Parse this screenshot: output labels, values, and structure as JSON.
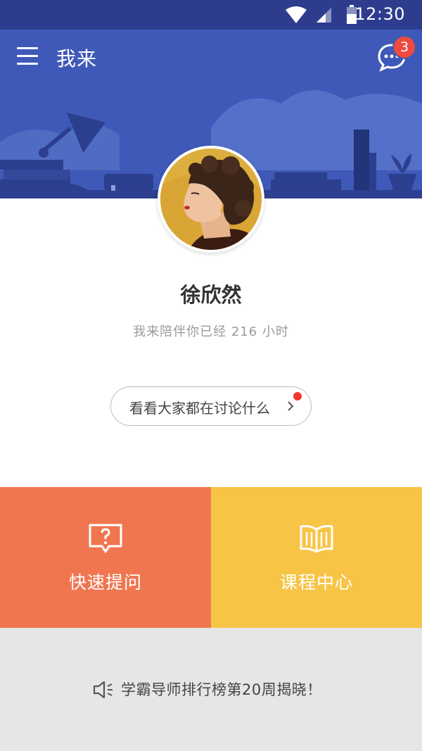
{
  "status_bar": {
    "time": "12:30"
  },
  "header": {
    "title": "我来",
    "message_count": "3"
  },
  "profile": {
    "name": "徐欣然",
    "companion_text": "我来陪伴你已经 216 小时"
  },
  "discuss_button": {
    "label": "看看大家都在讨论什么"
  },
  "tiles": [
    {
      "label": "快速提问",
      "icon": "question-bubble-icon",
      "color": "#f07650"
    },
    {
      "label": "课程中心",
      "icon": "open-book-icon",
      "color": "#f8c446"
    }
  ],
  "announcement": {
    "text": "学霸导师排行榜第20周揭晓！"
  },
  "colors": {
    "status_bar": "#2e3c8e",
    "banner": "#3f59b8",
    "badge": "#f04a3e"
  }
}
